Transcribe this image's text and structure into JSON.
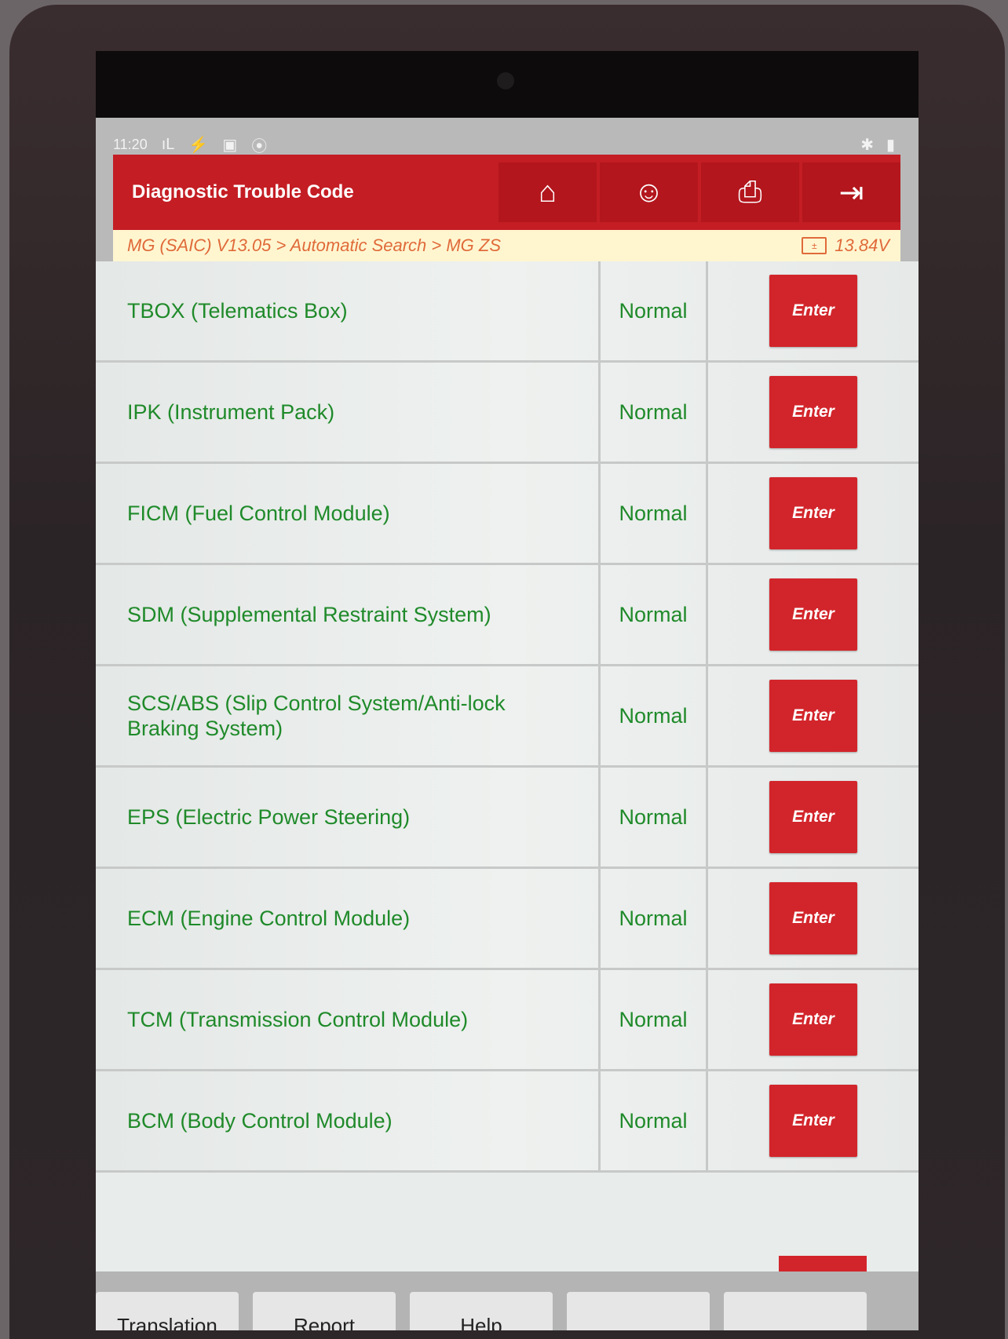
{
  "statusbar": {
    "time": "11:20",
    "icons_left": [
      "signal-icon",
      "usb-icon",
      "image-icon",
      "vci-icon"
    ],
    "icons_right": [
      "bluetooth-icon",
      "battery-icon"
    ]
  },
  "header": {
    "title": "Diagnostic Trouble Code",
    "nav": [
      "home-icon",
      "user-icon",
      "print-icon",
      "exit-icon"
    ]
  },
  "breadcrumb": {
    "path": "MG (SAIC) V13.05 > Automatic Search > MG ZS",
    "voltage": "13.84V"
  },
  "systems": [
    {
      "name": "TBOX (Telematics Box)",
      "status": "Normal",
      "action": "Enter"
    },
    {
      "name": "IPK (Instrument Pack)",
      "status": "Normal",
      "action": "Enter"
    },
    {
      "name": "FICM (Fuel Control Module)",
      "status": "Normal",
      "action": "Enter"
    },
    {
      "name": "SDM (Supplemental Restraint System)",
      "status": "Normal",
      "action": "Enter"
    },
    {
      "name": "SCS/ABS (Slip Control System/Anti-lock Braking System)",
      "status": "Normal",
      "action": "Enter"
    },
    {
      "name": "EPS (Electric Power Steering)",
      "status": "Normal",
      "action": "Enter"
    },
    {
      "name": "ECM (Engine Control Module)",
      "status": "Normal",
      "action": "Enter"
    },
    {
      "name": "TCM (Transmission Control Module)",
      "status": "Normal",
      "action": "Enter"
    },
    {
      "name": "BCM (Body Control Module)",
      "status": "Normal",
      "action": "Enter"
    }
  ],
  "footer": {
    "buttons": [
      "Translation",
      "Report",
      "Help",
      "",
      ""
    ]
  },
  "colors": {
    "accent": "#c41d24",
    "status_text": "#1f8a2a",
    "breadcrumb": "#e06a3a"
  }
}
